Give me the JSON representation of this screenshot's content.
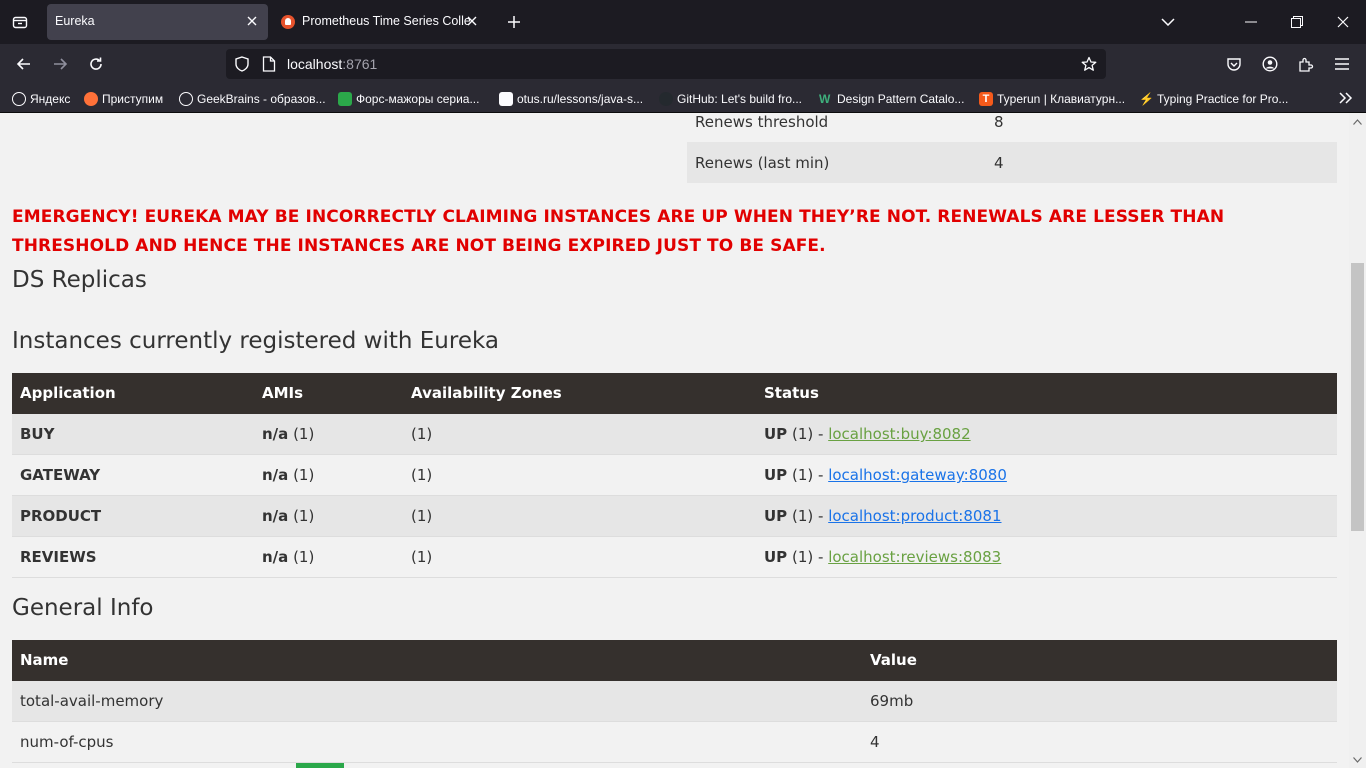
{
  "browser": {
    "tabs": [
      {
        "title": "Eureka",
        "active": true
      },
      {
        "title": "Prometheus Time Series Collect",
        "active": false
      }
    ],
    "url": {
      "host": "localhost",
      "port": ":8761"
    },
    "bookmarks": [
      {
        "label": "Яндекс",
        "color": "#ffffff"
      },
      {
        "label": "Приступим",
        "color": "#ff7139"
      },
      {
        "label": "GeekBrains - образов...",
        "color": "#ffffff"
      },
      {
        "label": "Форс-мажоры сериа...",
        "color": "#2ba84a"
      },
      {
        "label": "otus.ru/lessons/java-s...",
        "color": "#ffffff"
      },
      {
        "label": "GitHub: Let's build fro...",
        "color": "#24292e"
      },
      {
        "label": "Design Pattern Catalo...",
        "color": "#3eaf7c"
      },
      {
        "label": "Typerun | Клавиатурн...",
        "color": "#f55a1b"
      },
      {
        "label": "Typing Practice for Pro...",
        "color": "#2b2a33"
      }
    ]
  },
  "lease_info": {
    "rows": [
      {
        "name": "Renews threshold",
        "value": "8"
      },
      {
        "name": "Renews (last min)",
        "value": "4"
      }
    ]
  },
  "emergency_text": "EMERGENCY! EUREKA MAY BE INCORRECTLY CLAIMING INSTANCES ARE UP WHEN THEY’RE NOT. RENEWALS ARE LESSER THAN THRESHOLD AND HENCE THE INSTANCES ARE NOT BEING EXPIRED JUST TO BE SAFE.",
  "ds_replicas_title": "DS Replicas",
  "instances": {
    "title": "Instances currently registered with Eureka",
    "headers": [
      "Application",
      "AMIs",
      "Availability Zones",
      "Status"
    ],
    "rows": [
      {
        "app": "BUY",
        "ami": "n/a",
        "ami_count": "(1)",
        "zones": "(1)",
        "status": "UP",
        "status_count": "(1) -",
        "link": "localhost:buy:8082",
        "link_color": "green"
      },
      {
        "app": "GATEWAY",
        "ami": "n/a",
        "ami_count": "(1)",
        "zones": "(1)",
        "status": "UP",
        "status_count": "(1) -",
        "link": "localhost:gateway:8080",
        "link_color": "blue"
      },
      {
        "app": "PRODUCT",
        "ami": "n/a",
        "ami_count": "(1)",
        "zones": "(1)",
        "status": "UP",
        "status_count": "(1) -",
        "link": "localhost:product:8081",
        "link_color": "blue"
      },
      {
        "app": "REVIEWS",
        "ami": "n/a",
        "ami_count": "(1)",
        "zones": "(1)",
        "status": "UP",
        "status_count": "(1) -",
        "link": "localhost:reviews:8083",
        "link_color": "green"
      }
    ]
  },
  "general_info": {
    "title": "General Info",
    "headers": [
      "Name",
      "Value"
    ],
    "rows": [
      {
        "name": "total-avail-memory",
        "value": "69mb"
      },
      {
        "name": "num-of-cpus",
        "value": "4"
      }
    ]
  },
  "colors": {
    "emergency": "#e10000",
    "table_header": "#35302d",
    "link_green": "#69a142",
    "link_blue": "#1a73e8"
  }
}
